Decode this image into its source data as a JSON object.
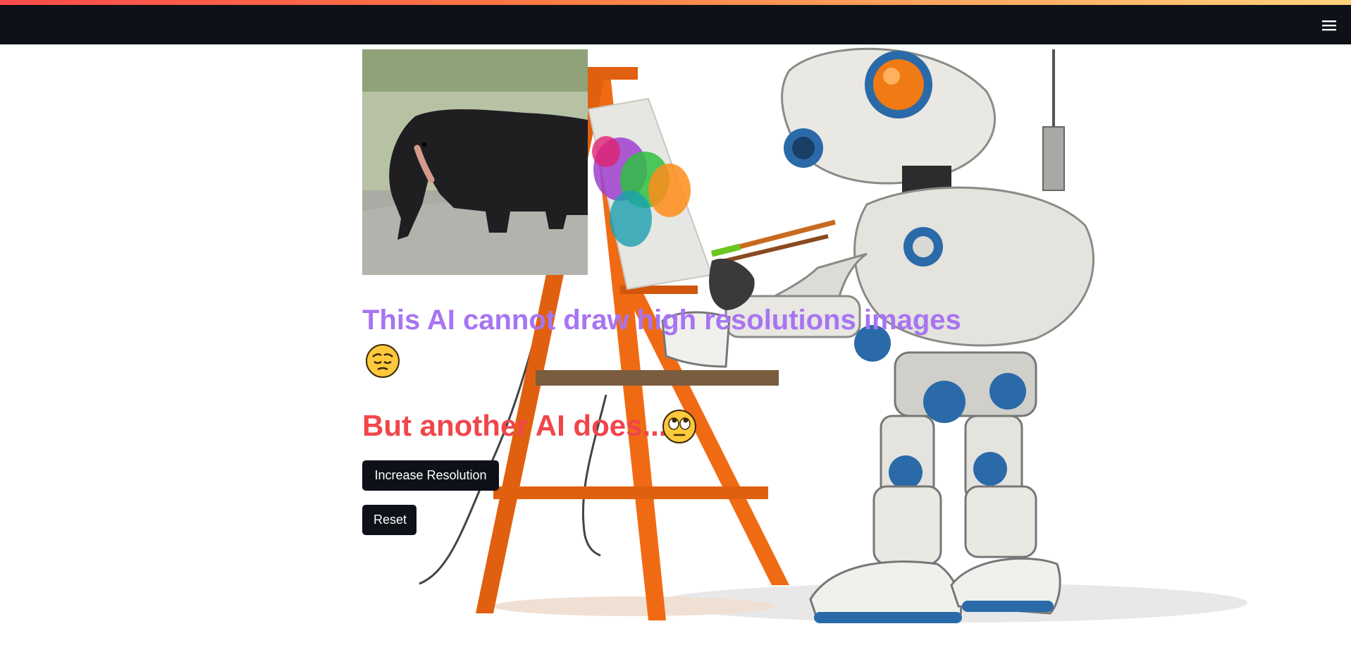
{
  "header": {
    "menu_icon": "hamburger-menu-icon",
    "background_color": "#0e1117",
    "accent_gradient": [
      "#ff4b4b",
      "#ff7a45",
      "#ffd37a"
    ]
  },
  "main": {
    "image_alt_subject": "elephant-photo",
    "heading_primary": "This AI cannot draw high resolutions images",
    "heading_primary_emoji": "pensive-face",
    "heading_primary_color": "#a774f2",
    "heading_secondary": "But another AI does...",
    "heading_secondary_emoji": "rolling-eyes-face",
    "heading_secondary_color": "#f0464b",
    "buttons": {
      "increase_label": "Increase Resolution",
      "reset_label": "Reset"
    }
  },
  "background": {
    "illustration": "robot-painting-at-easel"
  }
}
